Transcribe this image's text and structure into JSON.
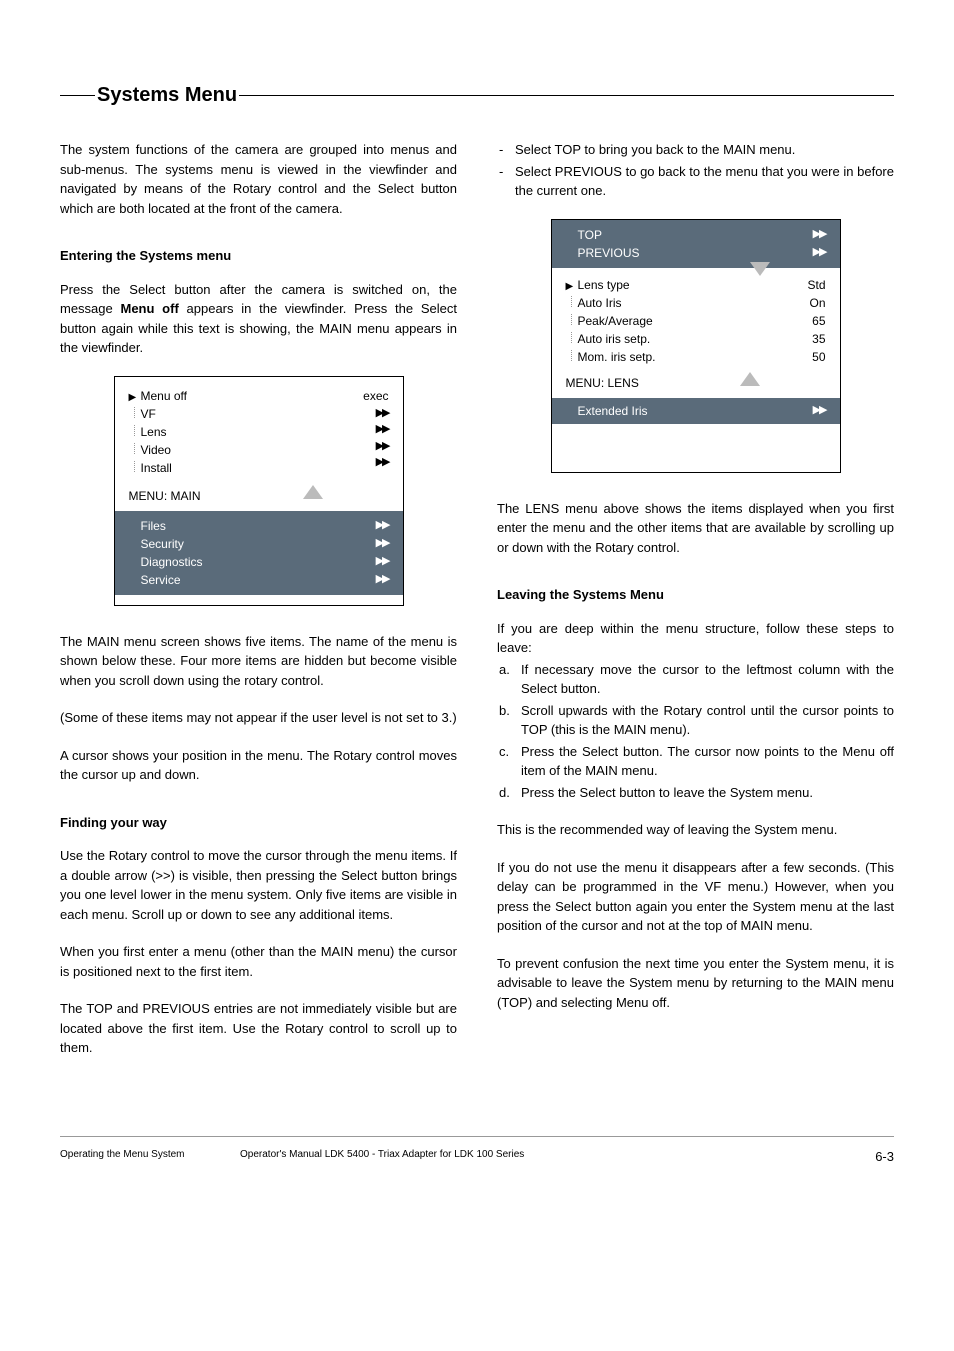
{
  "sectionTitle": "Systems Menu",
  "col1": {
    "intro": "The system functions of the camera are grouped into menus and sub-menus. The systems menu is viewed in the viewfinder and navigated by means of the Rotary control and the Select button which are both located at the front of the camera.",
    "h1": "Entering the Systems menu",
    "p1a": "Press the Select button after the camera is switched on, the message ",
    "p1bold": "Menu off",
    "p1b": " appears in the viewfinder. Press the Select button again while this text is showing, the MAIN menu appears in the viewfinder.",
    "mainMenu": {
      "items": [
        "Menu off",
        "VF",
        "Lens",
        "Video",
        "Install"
      ],
      "indicators": [
        "exec",
        "▶▶",
        "▶▶",
        "▶▶",
        "▶▶"
      ],
      "title": "MENU:  MAIN",
      "hidden": [
        "Files",
        "Security",
        "Diagnostics",
        "Service"
      ]
    },
    "p2": "The MAIN menu screen shows five items. The name of the menu is shown below these. Four more items are hidden but become visible when you scroll down using the rotary control.",
    "p3": "(Some of these items may not appear if the user level is not set to 3.)",
    "p4": "A cursor shows your position in the menu. The Rotary control moves the cursor up and down.",
    "h2": "Finding your way",
    "p5": "Use the Rotary control to move the cursor through the menu items. If a double arrow (>>) is visible, then pressing the Select button brings you one level lower in the menu system. Only five items are visible in each menu. Scroll up or down to see any additional items.",
    "p6": "When you first enter a menu (other than the MAIN menu) the cursor is positioned next to the first item.",
    "p7": " The TOP and PREVIOUS entries are not immediately visible but are located above the first item. Use the Rotary control to scroll up to them."
  },
  "col2": {
    "dash1": "Select TOP to bring you back to the MAIN menu.",
    "dash2": "Select PREVIOUS to go back to the menu that you were in before the current one.",
    "lensMenu": {
      "top": "TOP",
      "previous": "PREVIOUS",
      "items": [
        "Lens type",
        "Auto Iris",
        "Peak/Average",
        "Auto iris setp.",
        "Mom. iris setp."
      ],
      "values": [
        "Std",
        "On",
        "65",
        "35",
        "50"
      ],
      "title": "MENU:  LENS",
      "extended": "Extended Iris"
    },
    "p1": "The LENS menu above shows the items displayed when you first enter the menu and the other items that are available by scrolling up or down with the Rotary control.",
    "h1": "Leaving the Systems Menu",
    "p2": "If you are deep within the menu structure, follow these steps to leave:",
    "steps": [
      {
        "m": "a.",
        "t": "If necessary move the cursor to the leftmost column with the Select button."
      },
      {
        "m": "b.",
        "t": "Scroll upwards with the Rotary control until the cursor points to TOP (this is the MAIN menu)."
      },
      {
        "m": "c.",
        "t": "Press the Select button. The cursor now points to the Menu off item of the MAIN menu."
      },
      {
        "m": "d.",
        "t": "Press the Select button to leave the System menu."
      }
    ],
    "p3": "This is the recommended way of leaving the System menu.",
    "p4": "If you do not use the menu it disappears after a few seconds. (This delay can be programmed in the VF menu.) However, when you press the Select button again you enter the System menu at the last position of the cursor and not at the top of MAIN menu.",
    "p5": "To prevent confusion the next time you enter the System menu, it is advisable to leave the System menu by returning to the MAIN menu (TOP) and selecting Menu off."
  },
  "footer": {
    "left": "Operating the Menu System",
    "mid": "Operator's Manual LDK 5400 - Triax Adapter for LDK 100 Series",
    "right": "6-3"
  }
}
